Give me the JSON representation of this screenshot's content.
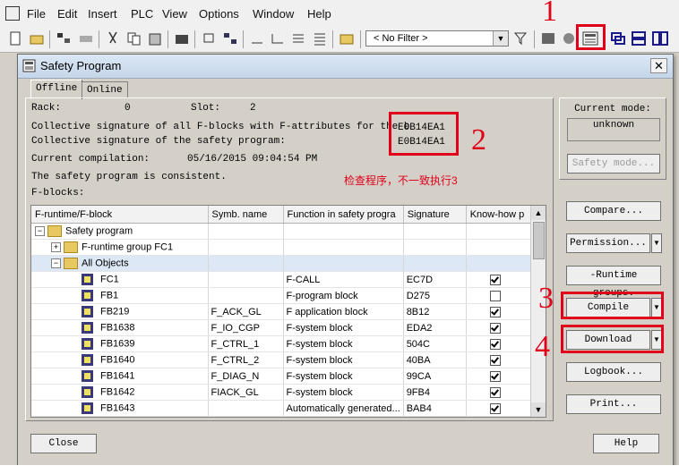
{
  "menubar": {
    "items": [
      "File",
      "Edit",
      "Insert",
      "PLC",
      "View",
      "Options",
      "Window",
      "Help"
    ]
  },
  "toolbar": {
    "filter_value": "< No Filter >"
  },
  "dialog": {
    "title": "Safety Program",
    "tabs": [
      "Offline",
      "Online"
    ],
    "rack_label": "Rack:",
    "rack_value": "0",
    "slot_label": "Slot:",
    "slot_value": "2",
    "collective_fblocks_label": "Collective signature of all F-blocks with F-attributes for the b",
    "collective_fblocks_value": "E0B14EA1",
    "collective_program_label": "Collective signature of the safety program:",
    "collective_program_value": "E0B14EA1",
    "compilation_label": "Current compilation:",
    "compilation_value": "05/16/2015 09:04:54 PM",
    "consistent_text": "The safety program is consistent.",
    "fblocks_label": "F-blocks:",
    "table": {
      "columns": [
        "F-runtime/F-block",
        "Symb. name",
        "Function in safety progra",
        "Signature",
        "Know-how p"
      ],
      "rows": [
        {
          "name": "Safety program",
          "symb": "",
          "func": "",
          "sig": "",
          "kh": null
        },
        {
          "name": "F-runtime group FC1",
          "symb": "",
          "func": "",
          "sig": "",
          "kh": null
        },
        {
          "name": "All Objects",
          "symb": "",
          "func": "",
          "sig": "",
          "kh": null
        },
        {
          "name": "FC1",
          "symb": "",
          "func": "F-CALL",
          "sig": "EC7D",
          "kh": true
        },
        {
          "name": "FB1",
          "symb": "",
          "func": "F-program block",
          "sig": "D275",
          "kh": false
        },
        {
          "name": "FB219",
          "symb": "F_ACK_GL",
          "func": "F application block",
          "sig": "8B12",
          "kh": true
        },
        {
          "name": "FB1638",
          "symb": "F_IO_CGP",
          "func": "F-system block",
          "sig": "EDA2",
          "kh": true
        },
        {
          "name": "FB1639",
          "symb": "F_CTRL_1",
          "func": "F-system block",
          "sig": "504C",
          "kh": true
        },
        {
          "name": "FB1640",
          "symb": "F_CTRL_2",
          "func": "F-system block",
          "sig": "40BA",
          "kh": true
        },
        {
          "name": "FB1641",
          "symb": "F_DIAG_N",
          "func": "F-system block",
          "sig": "99CA",
          "kh": true
        },
        {
          "name": "FB1642",
          "symb": "FIACK_GL",
          "func": "F-system block",
          "sig": "9FB4",
          "kh": true
        },
        {
          "name": "FB1643",
          "symb": "",
          "func": "Automatically generated...",
          "sig": "BAB4",
          "kh": true
        }
      ]
    },
    "current_mode_label": "Current mode:",
    "current_mode_value": "unknown",
    "buttons": {
      "safety_mode": "Safety mode...",
      "compare": "Compare...",
      "permission": "Permission...",
      "runtime_groups": "-Runtime groups.",
      "compile": "Compile",
      "download": "Download",
      "logbook": "Logbook...",
      "print": "Print...",
      "close": "Close",
      "help": "Help"
    }
  },
  "annotations": {
    "n1": "1",
    "n2": "2",
    "n3": "3",
    "n4": "4",
    "note": "检查程序，不一致执行3",
    "color": "#e0001a"
  }
}
